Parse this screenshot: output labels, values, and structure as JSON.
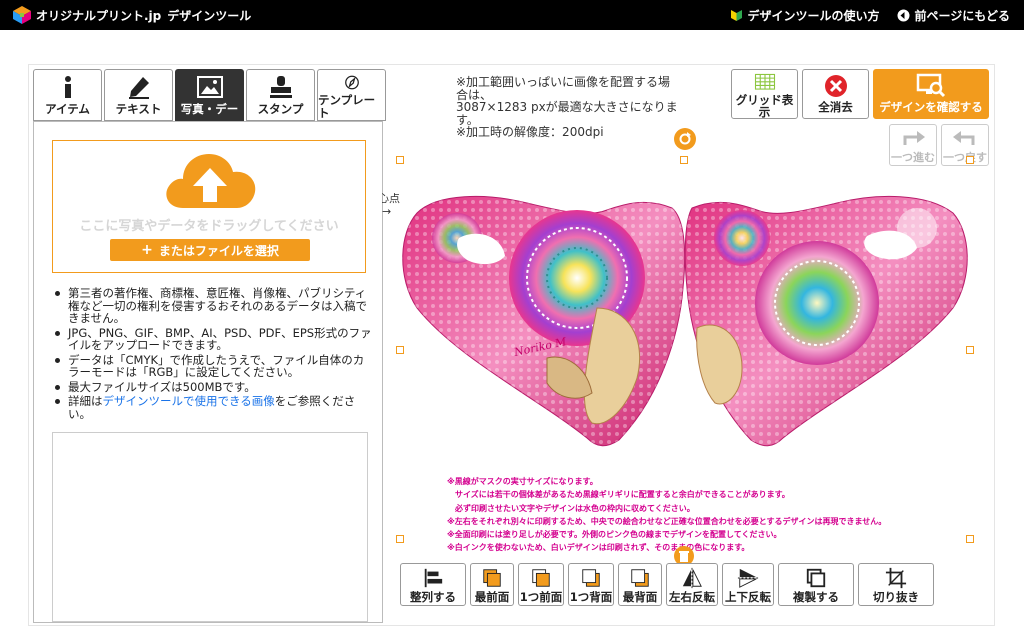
{
  "header": {
    "logo_text": "オリジナルプリント.jp",
    "app_title": "デザインツール",
    "how_to_label": "デザインツールの使い方",
    "back_label": "前ページにもどる"
  },
  "tabs": [
    {
      "label": "アイテム",
      "icon": "info-icon",
      "active": false
    },
    {
      "label": "テキスト",
      "icon": "pen-icon",
      "active": false
    },
    {
      "label": "写真・デー",
      "icon": "image-icon",
      "active": true
    },
    {
      "label": "スタンプ",
      "icon": "stamp-icon",
      "active": false
    },
    {
      "label": "テンプレート",
      "icon": "compass-icon",
      "active": false
    }
  ],
  "upload": {
    "drop_text": "ここに写真やデータをドラッグしてください",
    "file_button": "またはファイルを選択",
    "notes": [
      "第三者の著作権、商標権、意匠権、肖像権、パブリシティ権など一切の権利を侵害するおそれのあるデータは入稿できません。",
      "JPG、PNG、GIF、BMP、AI、PSD、PDF、EPS形式のファイルをアップロードできます。",
      "データは「CMYK」で作成したうえで、ファイル自体のカラーモードは「RGB」に設定してください。",
      "最大ファイルサイズは500MBです。"
    ],
    "last_note_prefix": "詳細は",
    "last_note_link": "デザインツールで使用できる画像",
    "last_note_suffix": "をご参照ください。"
  },
  "info": {
    "line1": "※加工範囲いっぱいに画像を配置する場合は、",
    "line2": "3087×1283 pxが最適な大きさになります。",
    "line3": "※加工時の解像度：200dpi"
  },
  "toolbar": {
    "grid_label": "グリッド表示",
    "clear_label": "全消去",
    "confirm_label": "デザインを確認する",
    "redo_label": "一つ進む",
    "undo_label": "一つ戻す"
  },
  "canvas": {
    "center_label": "中心点",
    "signature": "Noriko M"
  },
  "warnings": [
    "※黒線がマスクの実寸サイズになります。",
    "　サイズには若干の個体差があるため黒線ギリギリに配置すると余白ができることがあります。",
    "　必ず印刷させたい文字やデザインは水色の枠内に収めてください。",
    "※左右をそれぞれ別々に印刷するため、中央での絵合わせなど正確な位置合わせを必要とするデザインは再現できません。",
    "※全面印刷には塗り足しが必要です。外側のピンク色の線までデザインを配置してください。",
    "※白インクを使わないため、白いデザインは印刷されず、そのままの色になります。"
  ],
  "bottom_tools": [
    {
      "label": "整列する",
      "icon": "align-icon"
    },
    {
      "label": "最前面",
      "icon": "bring-front-icon"
    },
    {
      "label": "1つ前面",
      "icon": "bring-forward-icon"
    },
    {
      "label": "1つ背面",
      "icon": "send-backward-icon"
    },
    {
      "label": "最背面",
      "icon": "send-back-icon"
    },
    {
      "label": "左右反転",
      "icon": "flip-horizontal-icon"
    },
    {
      "label": "上下反転",
      "icon": "flip-vertical-icon"
    },
    {
      "label": "複製する",
      "icon": "duplicate-icon"
    },
    {
      "label": "切り抜き",
      "icon": "crop-icon"
    }
  ],
  "colors": {
    "accent": "#f29b1d",
    "warning": "#d4008f",
    "link": "#1a73e8",
    "clear_red": "#e0242a",
    "grid_green": "#8cc63f"
  }
}
